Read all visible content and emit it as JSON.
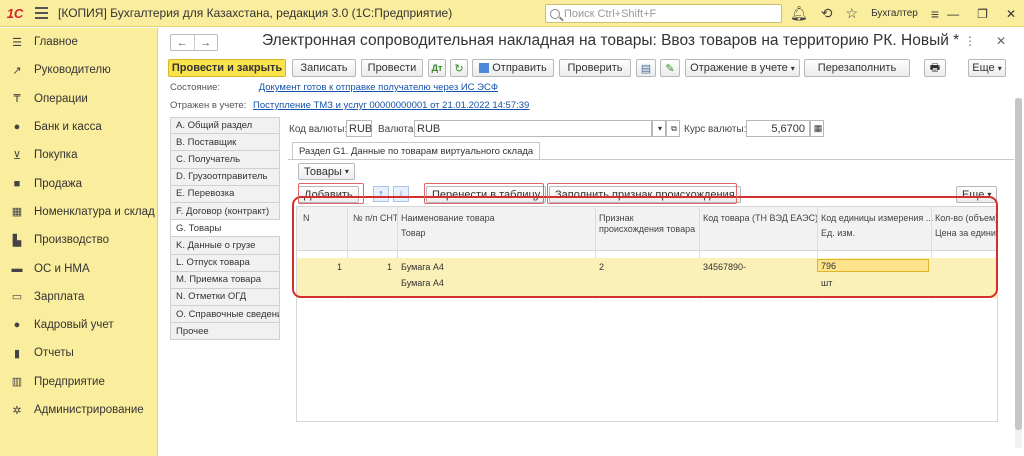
{
  "titlebar": {
    "logo": "1С",
    "title": "[КОПИЯ] Бухгалтерия для Казахстана, редакция 3.0  (1С:Предприятие)",
    "search_placeholder": "Поиск Ctrl+Shift+F",
    "user": "Бухгалтер"
  },
  "sidebar": {
    "items": [
      {
        "label": "Главное",
        "icon": "menu-icon"
      },
      {
        "label": "Руководителю",
        "icon": "chart-line-icon"
      },
      {
        "label": "Операции",
        "icon": "operations-icon"
      },
      {
        "label": "Банк и касса",
        "icon": "coin-icon"
      },
      {
        "label": "Покупка",
        "icon": "cart-icon"
      },
      {
        "label": "Продажа",
        "icon": "bag-icon"
      },
      {
        "label": "Номенклатура и склад",
        "icon": "warehouse-icon"
      },
      {
        "label": "Производство",
        "icon": "factory-icon"
      },
      {
        "label": "ОС и НМА",
        "icon": "truck-icon"
      },
      {
        "label": "Зарплата",
        "icon": "wallet-icon"
      },
      {
        "label": "Кадровый учет",
        "icon": "users-icon"
      },
      {
        "label": "Отчеты",
        "icon": "bar-chart-icon"
      },
      {
        "label": "Предприятие",
        "icon": "building-icon"
      },
      {
        "label": "Администрирование",
        "icon": "gear-icon"
      }
    ]
  },
  "doc": {
    "title": "Электронная сопроводительная накладная на товары: Ввоз товаров на территорию РК. Новый *",
    "toolbar": {
      "post_close": "Провести и закрыть",
      "save": "Записать",
      "post": "Провести",
      "send": "Отправить",
      "check": "Проверить",
      "reflect": "Отражение в учете",
      "refill": "Перезаполнить",
      "more": "Еще"
    },
    "state_label": "Состояние:",
    "state_value": "Документ готов к отправке получателю через ИС ЭСФ",
    "reflect_label": "Отражен в учете:",
    "reflect_value": "Поступление ТМЗ и услуг 00000000001 от 21.01.2022 14:57:39"
  },
  "sections": [
    "A. Общий раздел",
    "B. Поставщик",
    "C. Получатель",
    "D. Грузоотправитель",
    "E. Перевозка",
    "F. Договор (контракт)",
    "G. Товары",
    "K. Данные о грузе",
    "L. Отпуск товара",
    "M. Приемка товара",
    "N. Отметки ОГД",
    "O. Справочные сведения",
    "Прочее"
  ],
  "currency": {
    "code_label": "Код валюты:",
    "code_value": "RUB",
    "currency_label": "Валюта:",
    "currency_value": "RUB",
    "rate_label": "Курс валюты:",
    "rate_value": "5,6700"
  },
  "tab": {
    "label": "Раздел G1. Данные по товарам виртуального склада"
  },
  "goods_menu": "Товары",
  "table_toolbar": {
    "add": "Добавить",
    "move_to_table": "Перенести в таблицу",
    "fill_origin": "Заполнить признак происхождения",
    "more": "Еще"
  },
  "table": {
    "headers": {
      "n": "N",
      "pp": "№ п/п СНТ",
      "name": "Наименование товара",
      "goods": "Товар",
      "origin_1": "Признак",
      "origin_2": "происхождения товара",
      "tnved": "Код товара (ТН ВЭД ЕАЭС)",
      "unit_code": "Код единицы измерения ...",
      "unit": "Ед. изм.",
      "qty": "Кол-во (объем)",
      "price": "Цена за единиц..."
    },
    "rows": [
      {
        "n": "1",
        "pp": "1",
        "name": "Бумага А4",
        "goods": "Бумага А4",
        "origin": "2",
        "tnved": "34567890-",
        "unit_code": "796",
        "unit": "шт"
      }
    ]
  }
}
